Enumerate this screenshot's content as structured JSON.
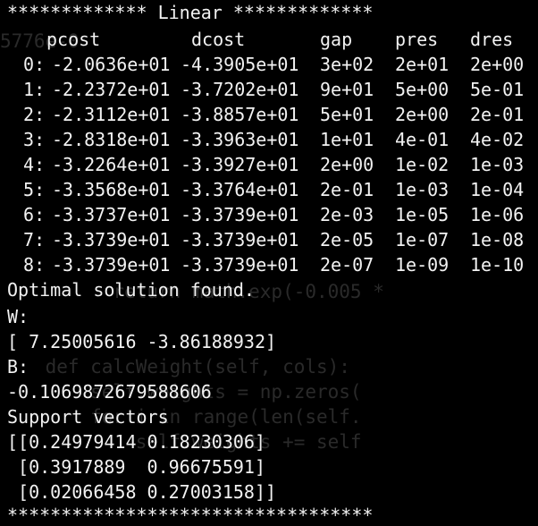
{
  "colors": {
    "background": "#000000",
    "text": "#f2f2f2",
    "ghost_text": "#2a2a2a"
  },
  "background_code": {
    "lines": [
      "5776e-0",
      "                               ",
      "                              i(o",
      "                              ",
      "                              ",
      "                            ",
      "                         (",
      "                              ",
      "                           [",
      "          return math.exp(-0.005 *",
      "                              ",
      "    def calcWeight(self, cols):",
      "        self.weights = np.zeros(",
      "        for i in range(len(self.",
      "            self.weights += self",
      "                              "
    ]
  },
  "terminal": {
    "header_line": "************* Linear *************",
    "columns": [
      "pcost",
      "dcost",
      "gap",
      "pres",
      "dres"
    ],
    "iterations": [
      {
        "k": " 0:",
        "pcost": "-2.0636e+01",
        "dcost": "-4.3905e+01",
        "gap": "3e+02",
        "pres": "2e+01",
        "dres": "2e+00"
      },
      {
        "k": " 1:",
        "pcost": "-2.2372e+01",
        "dcost": "-3.7202e+01",
        "gap": "9e+01",
        "pres": "5e+00",
        "dres": "5e-01"
      },
      {
        "k": " 2:",
        "pcost": "-2.3112e+01",
        "dcost": "-3.8857e+01",
        "gap": "5e+01",
        "pres": "2e+00",
        "dres": "2e-01"
      },
      {
        "k": " 3:",
        "pcost": "-2.8318e+01",
        "dcost": "-3.3963e+01",
        "gap": "1e+01",
        "pres": "4e-01",
        "dres": "4e-02"
      },
      {
        "k": " 4:",
        "pcost": "-3.2264e+01",
        "dcost": "-3.3927e+01",
        "gap": "2e+00",
        "pres": "1e-02",
        "dres": "1e-03"
      },
      {
        "k": " 5:",
        "pcost": "-3.3568e+01",
        "dcost": "-3.3764e+01",
        "gap": "2e-01",
        "pres": "1e-03",
        "dres": "1e-04"
      },
      {
        "k": " 6:",
        "pcost": "-3.3737e+01",
        "dcost": "-3.3739e+01",
        "gap": "2e-03",
        "pres": "1e-05",
        "dres": "1e-06"
      },
      {
        "k": " 7:",
        "pcost": "-3.3739e+01",
        "dcost": "-3.3739e+01",
        "gap": "2e-05",
        "pres": "1e-07",
        "dres": "1e-08"
      },
      {
        "k": " 8:",
        "pcost": "-3.3739e+01",
        "dcost": "-3.3739e+01",
        "gap": "2e-07",
        "pres": "1e-09",
        "dres": "1e-10"
      }
    ],
    "status_line": "Optimal solution found.",
    "w_label": "W:",
    "w_value": "[ 7.25005616 -3.86188932]",
    "b_label": "B:",
    "b_value": "-0.1069872679588606",
    "sv_label": "Support vectors",
    "sv_rows": [
      "[[0.24979414 0.18230306]",
      " [0.3917889  0.96675591]",
      " [0.02066458 0.27003158]]"
    ],
    "footer_line": "**********************************"
  }
}
